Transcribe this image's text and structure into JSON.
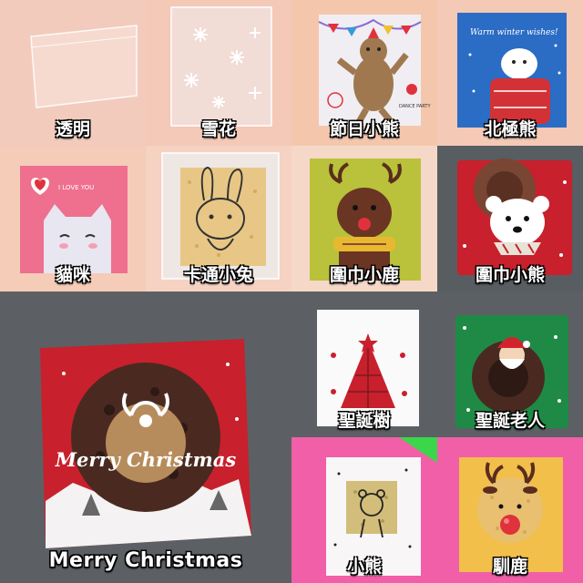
{
  "tiles": [
    {
      "label": "透明"
    },
    {
      "label": "雪花"
    },
    {
      "label": "節日小熊",
      "print": "DANCE PARTY"
    },
    {
      "label": "北極熊",
      "print": "Warm winter wishes!"
    },
    {
      "label": "貓咪",
      "print": "I LOVE YOU"
    },
    {
      "label": "卡通小兔"
    },
    {
      "label": "圍巾小鹿"
    },
    {
      "label": "圍巾小熊"
    },
    {
      "label": "Merry Christmas",
      "print": "Merry Christmas"
    },
    {
      "label": "聖誕樹"
    },
    {
      "label": "聖誕老人"
    },
    {
      "label": "小熊"
    },
    {
      "label": "馴鹿"
    }
  ],
  "colors": {
    "christmas_red": "#c8202c",
    "olive": "#b9c23a",
    "kraft": "#e8a868",
    "grey_bg": "#555a5e",
    "peach_bg": "#f3cdb6"
  }
}
